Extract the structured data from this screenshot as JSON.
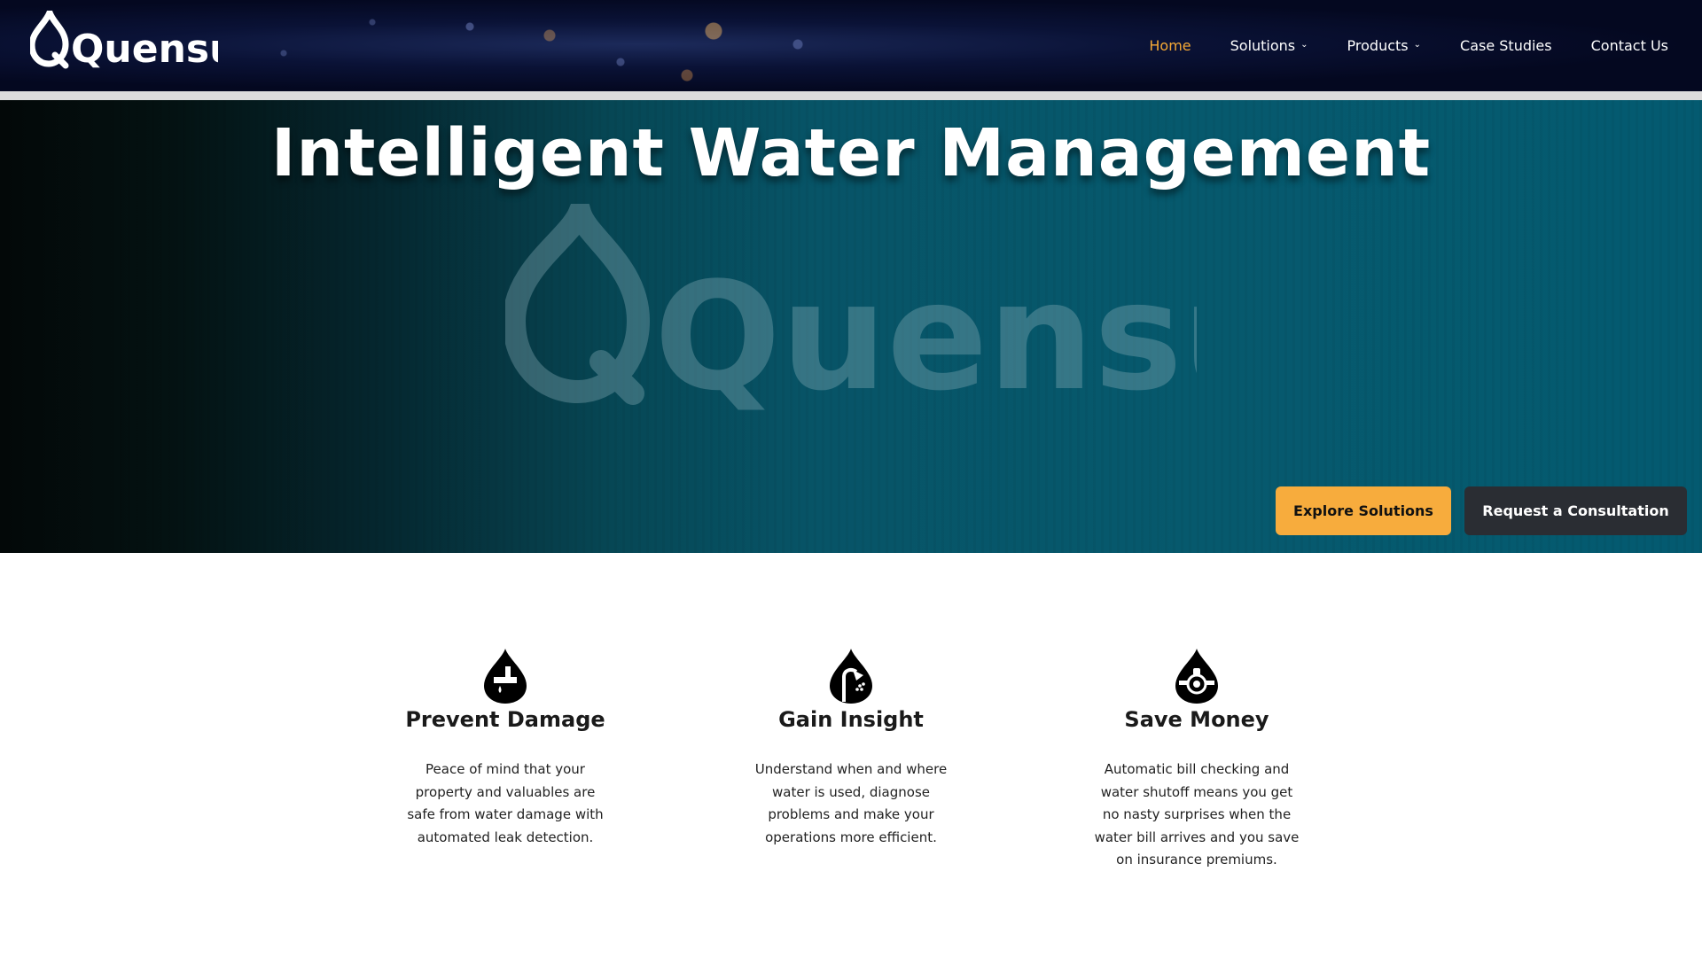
{
  "brand": {
    "name": "Quensus",
    "accent": "#f6a935"
  },
  "nav": {
    "items": [
      {
        "label": "Home",
        "active": true,
        "dropdown": false
      },
      {
        "label": "Solutions",
        "active": false,
        "dropdown": true
      },
      {
        "label": "Products",
        "active": false,
        "dropdown": true
      },
      {
        "label": "Case Studies",
        "active": false,
        "dropdown": false
      },
      {
        "label": "Contact Us",
        "active": false,
        "dropdown": false
      }
    ]
  },
  "hero": {
    "title": "Intelligent Water Management",
    "watermark": "Quensus",
    "primary_button": "Explore Solutions",
    "secondary_button": "Request a Consultation"
  },
  "features": [
    {
      "icon": "water-drop-pipe-leak-icon",
      "title": "Prevent Damage",
      "desc": "Peace of mind that your property and valuables are safe from water damage with automated leak detection."
    },
    {
      "icon": "water-drop-shower-icon",
      "title": "Gain Insight",
      "desc": "Understand when and where water is used, diagnose problems and make your operations more efficient."
    },
    {
      "icon": "water-drop-meter-icon",
      "title": "Save Money",
      "desc": "Automatic bill checking and water shutoff means you get no nasty surprises when the water bill arrives and you save on insurance premiums."
    }
  ]
}
